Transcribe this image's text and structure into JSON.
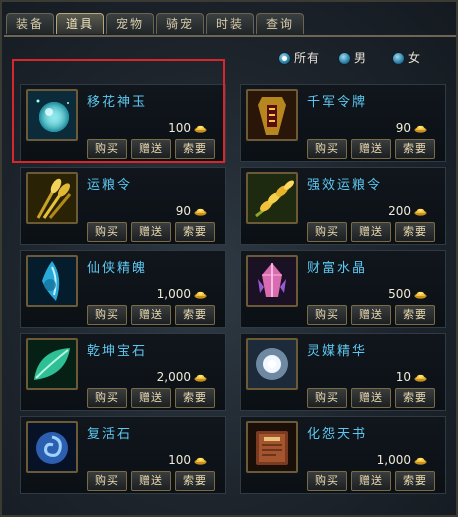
{
  "tabs": [
    "装备",
    "道具",
    "宠物",
    "骑宠",
    "时装",
    "查询"
  ],
  "active_tab": "道具",
  "filters": {
    "options": [
      "所有",
      "男",
      "女"
    ],
    "selected": "所有"
  },
  "buttons": {
    "buy": "购买",
    "gift": "赠送",
    "ask": "索要"
  },
  "currency_icon": "gold-ingot-icon",
  "items": [
    {
      "name": "移花神玉",
      "price": "100",
      "icon": "jade-orb-icon"
    },
    {
      "name": "千军令牌",
      "price": "90",
      "icon": "command-token-icon"
    },
    {
      "name": "运粮令",
      "price": "90",
      "icon": "wheat-icon"
    },
    {
      "name": "强效运粮令",
      "price": "200",
      "icon": "golden-wheat-icon"
    },
    {
      "name": "仙侠精魄",
      "price": "1,000",
      "icon": "spirit-crystal-icon"
    },
    {
      "name": "财富水晶",
      "price": "500",
      "icon": "wealth-crystal-icon"
    },
    {
      "name": "乾坤宝石",
      "price": "2,000",
      "icon": "jade-leaf-gem-icon"
    },
    {
      "name": "灵媒精华",
      "price": "10",
      "icon": "light-essence-icon"
    },
    {
      "name": "复活石",
      "price": "100",
      "icon": "revival-stone-icon"
    },
    {
      "name": "化怨天书",
      "price": "1,000",
      "icon": "heavenly-book-icon"
    }
  ],
  "colors": {
    "item_name": "#5cc8f2",
    "highlight": "#d8262b",
    "tab_text": "#d9ccaa"
  }
}
